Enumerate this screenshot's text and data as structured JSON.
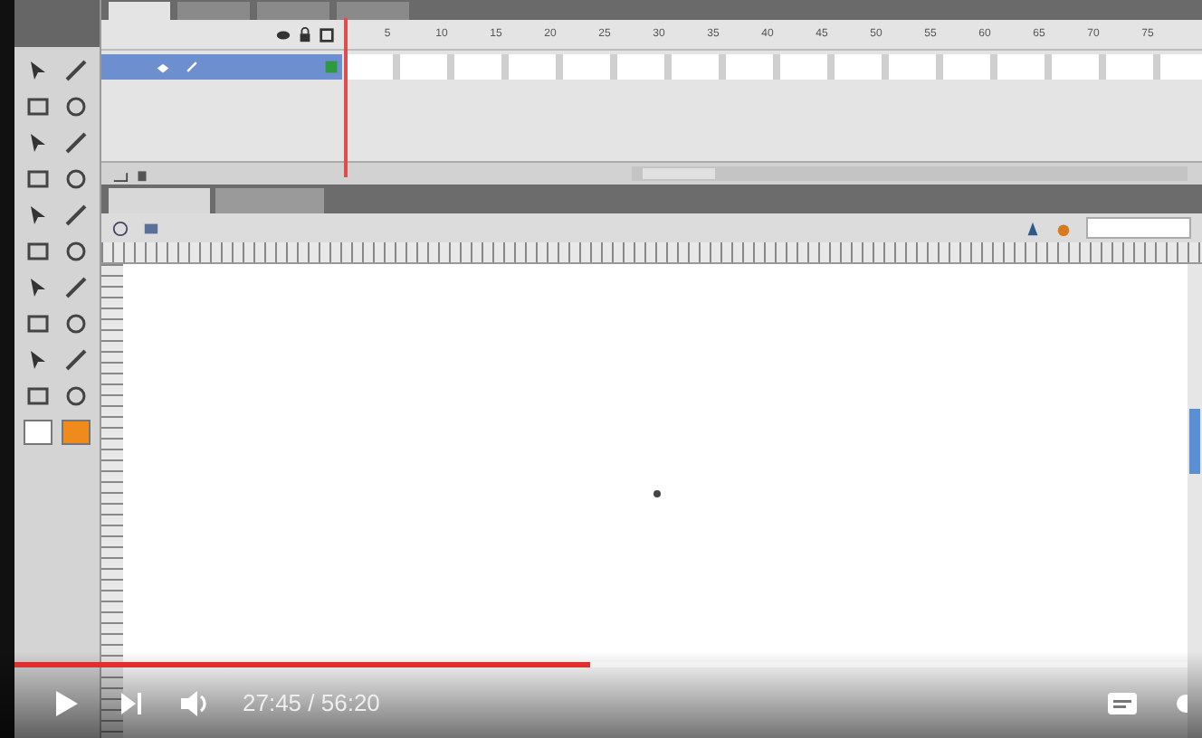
{
  "timeline": {
    "frame_numbers": [
      "5",
      "10",
      "15",
      "20",
      "25",
      "30",
      "35",
      "40",
      "45",
      "50",
      "55",
      "60",
      "65",
      "70",
      "75"
    ],
    "panel_tabs": [
      {
        "selected": true
      },
      {
        "selected": false
      },
      {
        "selected": false
      },
      {
        "selected": false
      }
    ],
    "layers": [
      {
        "selected": true
      }
    ]
  },
  "document_tabs": [
    {
      "selected": true
    },
    {
      "selected": false
    }
  ],
  "video_player": {
    "progress": {
      "level": 0.49
    },
    "time": "27:45 / 56:20"
  }
}
